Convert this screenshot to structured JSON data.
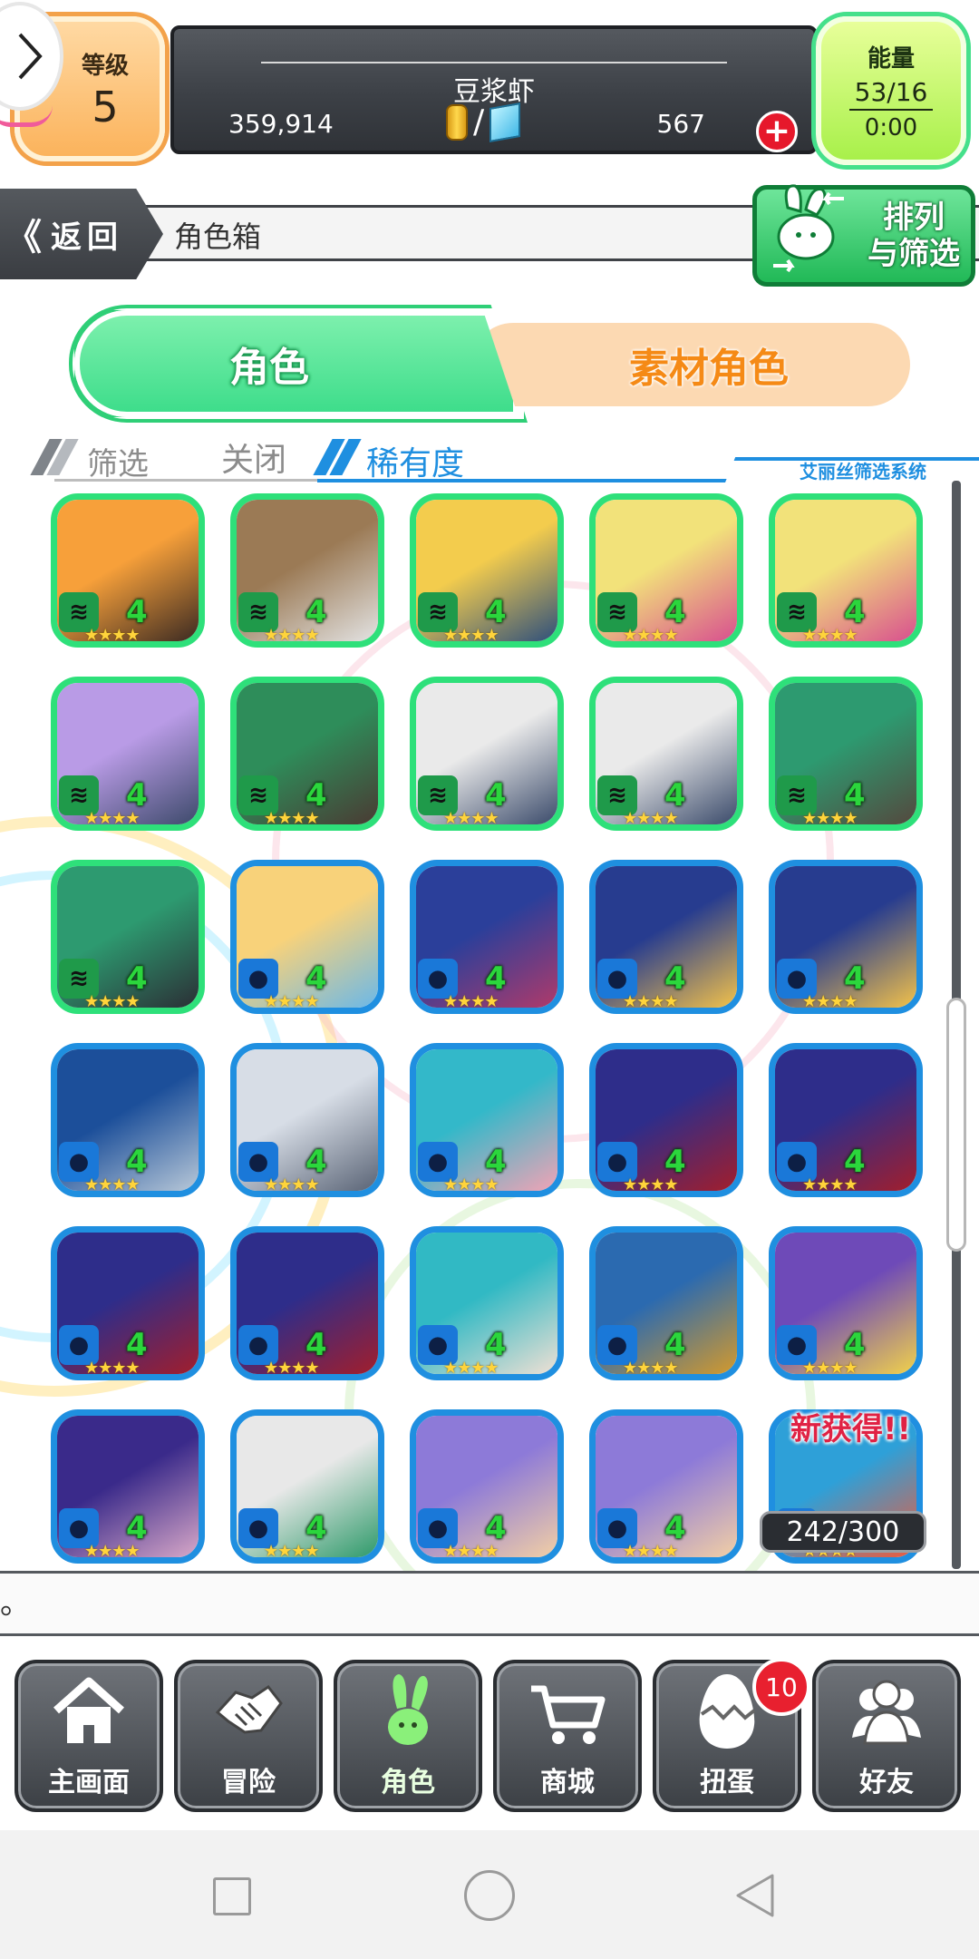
{
  "status": {
    "level_label": "等级",
    "level_value": "5",
    "player_name": "豆浆虾",
    "coins": "359,914",
    "currency_separator": "/",
    "gems": "567",
    "energy_label": "能量",
    "energy_value": "53/16",
    "energy_timer": "0:00"
  },
  "nav": {
    "back_chevrons": "《",
    "back_label": "返回",
    "page_title": "角色箱",
    "sort_label_line1": "排列",
    "sort_label_line2": "与筛选"
  },
  "tabs": [
    {
      "label": "角色",
      "active": true
    },
    {
      "label": "素材角色",
      "active": false
    }
  ],
  "filter": {
    "filter_label": "筛选",
    "filter_state": "关闭",
    "sort_by": "稀有度",
    "system_name": "艾丽丝筛选系统"
  },
  "characters": [
    {
      "element": "wind",
      "level": "4",
      "stars": "★★★★",
      "art": [
        "#f7a03a",
        "#3b2a22"
      ]
    },
    {
      "element": "wind",
      "level": "4",
      "stars": "★★★★",
      "art": [
        "#9b7a55",
        "#e3e3e3"
      ]
    },
    {
      "element": "wind",
      "level": "4",
      "stars": "★★★★",
      "art": [
        "#f3cc4d",
        "#2e4f7c"
      ]
    },
    {
      "element": "wind",
      "level": "4",
      "stars": "★★★★",
      "art": [
        "#f2e27a",
        "#d84f8f"
      ]
    },
    {
      "element": "wind",
      "level": "4",
      "stars": "★★★★",
      "art": [
        "#f2e27a",
        "#d84f8f"
      ]
    },
    {
      "element": "wind",
      "level": "4",
      "stars": "★★★★",
      "art": [
        "#b99be6",
        "#3d4a6b"
      ]
    },
    {
      "element": "wind",
      "level": "4",
      "stars": "★★★★",
      "art": [
        "#2e8d5a",
        "#4a3a33"
      ]
    },
    {
      "element": "wind",
      "level": "4",
      "stars": "★★★★",
      "art": [
        "#eaeaea",
        "#3b4b6b"
      ]
    },
    {
      "element": "wind",
      "level": "4",
      "stars": "★★★★",
      "art": [
        "#eaeaea",
        "#3b4b6b"
      ]
    },
    {
      "element": "wind",
      "level": "4",
      "stars": "★★★★",
      "art": [
        "#2d9a70",
        "#54483e"
      ]
    },
    {
      "element": "wind",
      "level": "4",
      "stars": "★★★★",
      "art": [
        "#2d9a70",
        "#2b2e35"
      ]
    },
    {
      "element": "water",
      "level": "4",
      "stars": "★★★★",
      "art": [
        "#f8d27a",
        "#6bb8e8"
      ]
    },
    {
      "element": "water",
      "level": "4",
      "stars": "★★★★",
      "art": [
        "#2b3f9a",
        "#b03a6a"
      ]
    },
    {
      "element": "water",
      "level": "4",
      "stars": "★★★★",
      "art": [
        "#273c8f",
        "#f3c24a"
      ]
    },
    {
      "element": "water",
      "level": "4",
      "stars": "★★★★",
      "art": [
        "#273c8f",
        "#f3c24a"
      ]
    },
    {
      "element": "water",
      "level": "4",
      "stars": "★★★★",
      "art": [
        "#1c4f9a",
        "#b8c8d8"
      ]
    },
    {
      "element": "water",
      "level": "4",
      "stars": "★★★★",
      "art": [
        "#d7dde6",
        "#5a6476"
      ]
    },
    {
      "element": "water",
      "level": "4",
      "stars": "★★★★",
      "art": [
        "#33b8c9",
        "#f2a3b5"
      ]
    },
    {
      "element": "water",
      "level": "4",
      "stars": "★★★★",
      "art": [
        "#2e2d8a",
        "#a21e2c"
      ]
    },
    {
      "element": "water",
      "level": "4",
      "stars": "★★★★",
      "art": [
        "#2e2d8a",
        "#a21e2c"
      ]
    },
    {
      "element": "water",
      "level": "4",
      "stars": "★★★★",
      "art": [
        "#2e2d8a",
        "#a21e2c"
      ]
    },
    {
      "element": "water",
      "level": "4",
      "stars": "★★★★",
      "art": [
        "#2e2d8a",
        "#a21e2c"
      ]
    },
    {
      "element": "water",
      "level": "4",
      "stars": "★★★★",
      "art": [
        "#31b9c4",
        "#f0e0d4"
      ]
    },
    {
      "element": "water",
      "level": "4",
      "stars": "★★★★",
      "art": [
        "#2b6ab0",
        "#d49a2c"
      ]
    },
    {
      "element": "water",
      "level": "4",
      "stars": "★★★★",
      "art": [
        "#6e4ab8",
        "#f2d24a"
      ]
    },
    {
      "element": "water",
      "level": "4",
      "stars": "★★★★",
      "art": [
        "#3a2a8a",
        "#d8a8c8"
      ]
    },
    {
      "element": "water",
      "level": "4",
      "stars": "★★★★",
      "art": [
        "#e8e8e8",
        "#2e9a6a"
      ]
    },
    {
      "element": "water",
      "level": "4",
      "stars": "★★★★",
      "art": [
        "#8d7ad8",
        "#f2cfa5"
      ]
    },
    {
      "element": "water",
      "level": "4",
      "stars": "★★★★",
      "art": [
        "#8d7ad8",
        "#f2cfa5"
      ]
    },
    {
      "element": "water",
      "level": "4",
      "stars": "★★★★",
      "art": [
        "#2ea0d8",
        "#f05a3a"
      ]
    }
  ],
  "box": {
    "new_badge": "新获得!!",
    "count": "242/300"
  },
  "message": "。",
  "bottom_nav": {
    "items": [
      {
        "label": "主画面",
        "icon": "home-icon"
      },
      {
        "label": "冒险",
        "icon": "handshake-icon"
      },
      {
        "label": "角色",
        "icon": "rabbit-icon",
        "active": true
      },
      {
        "label": "商城",
        "icon": "cart-icon"
      },
      {
        "label": "扭蛋",
        "icon": "egg-icon"
      },
      {
        "label": "好友",
        "icon": "friends-icon"
      }
    ],
    "egg_badge": "10"
  },
  "colors": {
    "wind_border": "#2ee07a",
    "water_border": "#1f8fe0",
    "level_text": "#2bd63c"
  }
}
